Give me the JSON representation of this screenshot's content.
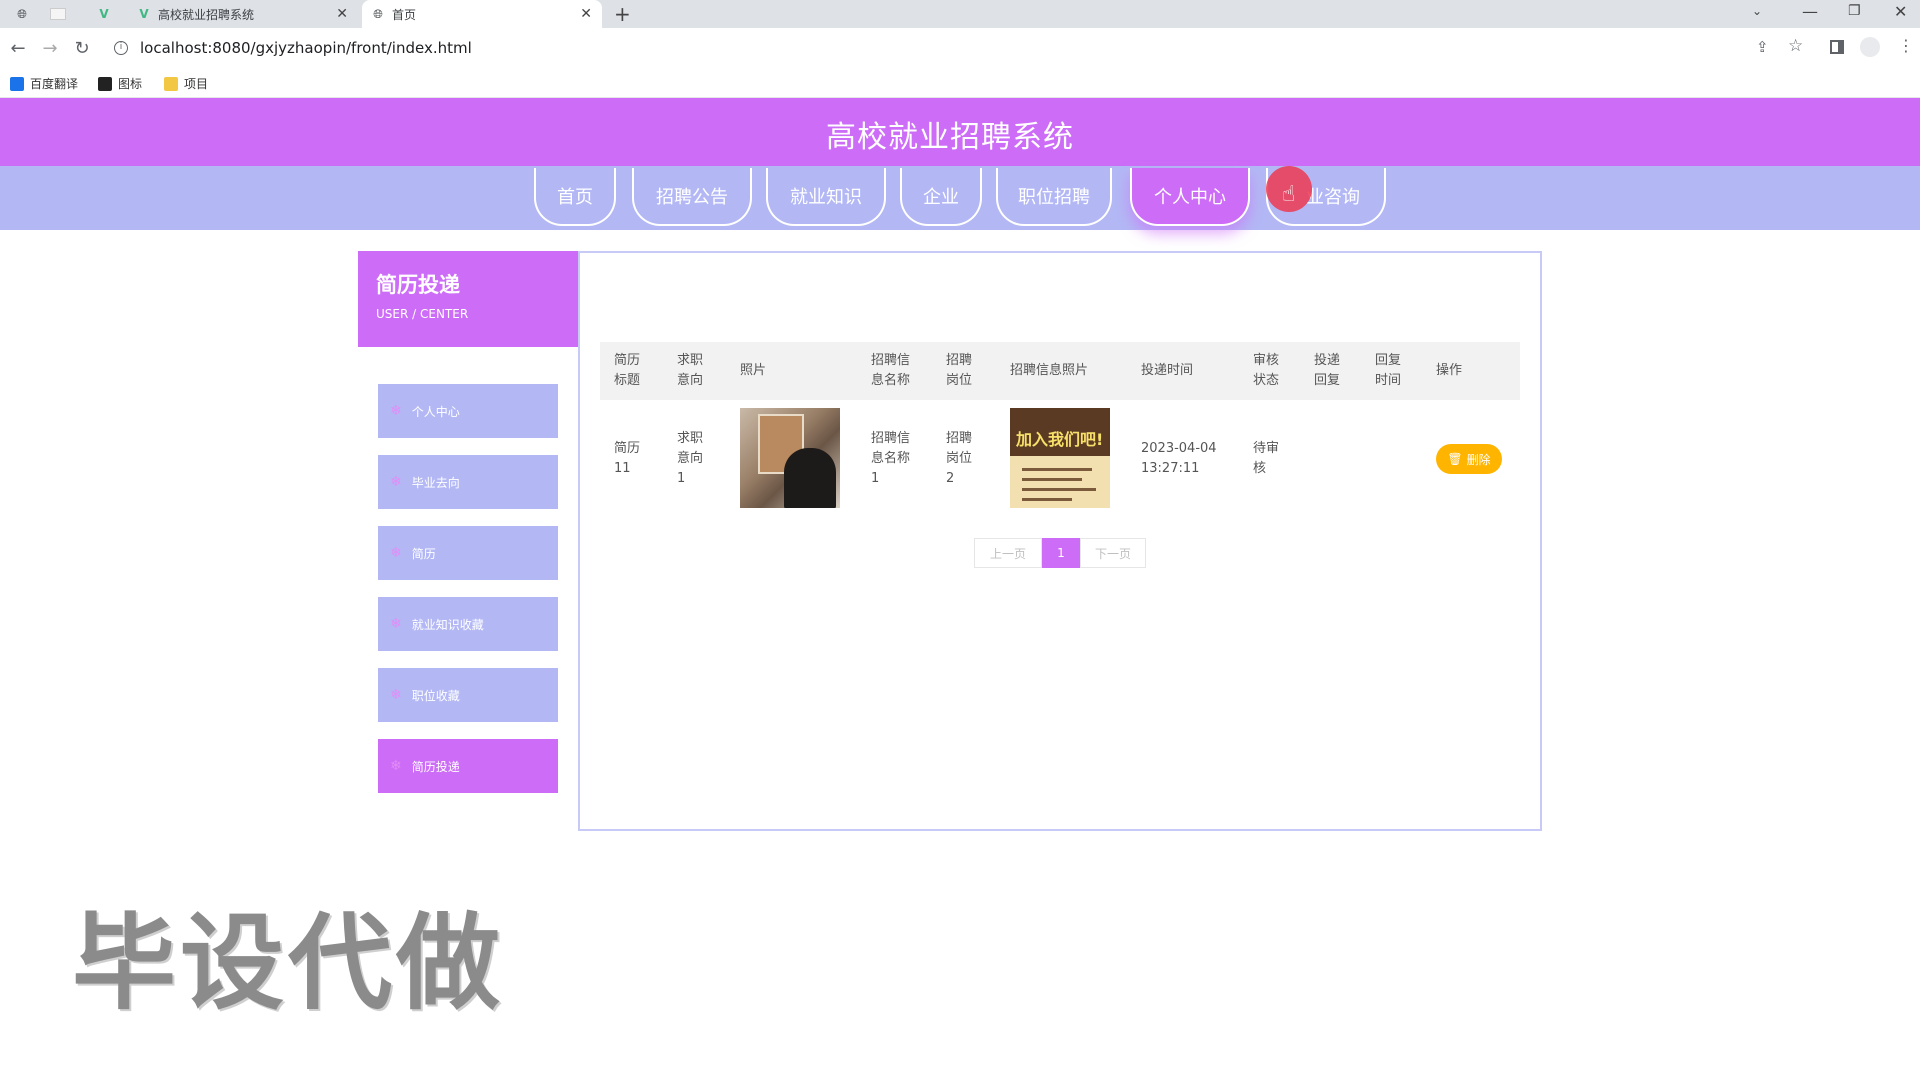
{
  "browser": {
    "tabs": [
      {
        "title": "高校就业招聘系统"
      },
      {
        "title": "首页"
      }
    ],
    "new_tab_symbol": "+",
    "url": "localhost:8080/gxjyzhaopin/front/index.html",
    "bookmarks": [
      {
        "label": "百度翻译",
        "icon": "translate-icon",
        "color": "#1a73e8"
      },
      {
        "label": "图标",
        "icon": "image-icon",
        "color": "#222222"
      },
      {
        "label": "项目",
        "icon": "folder-icon",
        "color": "#f2c744"
      }
    ]
  },
  "site": {
    "title": "高校就业招聘系统",
    "nav": [
      {
        "label": "首页"
      },
      {
        "label": "招聘公告"
      },
      {
        "label": "就业知识"
      },
      {
        "label": "企业"
      },
      {
        "label": "职位招聘"
      },
      {
        "label": "个人中心",
        "active": true
      },
      {
        "label": "就业咨询"
      }
    ],
    "nav_partial_label": "业咨询"
  },
  "sidebar": {
    "title": "简历投递",
    "subtitle": "USER / CENTER",
    "items": [
      {
        "label": "个人中心"
      },
      {
        "label": "毕业去向"
      },
      {
        "label": "简历"
      },
      {
        "label": "就业知识收藏"
      },
      {
        "label": "职位收藏"
      },
      {
        "label": "简历投递",
        "active": true
      }
    ]
  },
  "table": {
    "headers": [
      {
        "l1": "简历",
        "l2": "标题"
      },
      {
        "l1": "求职",
        "l2": "意向"
      },
      {
        "l1": "照片",
        "l2": ""
      },
      {
        "l1": "招聘信",
        "l2": "息名称"
      },
      {
        "l1": "招聘",
        "l2": "岗位"
      },
      {
        "l1": "招聘信息照片",
        "l2": ""
      },
      {
        "l1": "投递时间",
        "l2": ""
      },
      {
        "l1": "审核",
        "l2": "状态"
      },
      {
        "l1": "投递",
        "l2": "回复"
      },
      {
        "l1": "回复",
        "l2": "时间"
      },
      {
        "l1": "操作",
        "l2": ""
      }
    ],
    "row": {
      "resume_title": [
        "简历",
        "11"
      ],
      "intention": [
        "求职",
        "意向",
        "1"
      ],
      "job_info_name": [
        "招聘信",
        "息名称",
        "1"
      ],
      "job_position": [
        "招聘",
        "岗位",
        "2"
      ],
      "delivery_time": [
        "2023-04-04",
        "13:27:11"
      ],
      "review_status": [
        "待审",
        "核"
      ],
      "reply": "",
      "reply_time": "",
      "poster_text": "加入我们吧!",
      "delete_label": "删除"
    }
  },
  "pagination": {
    "prev": "上一页",
    "current": "1",
    "next": "下一页"
  },
  "watermark": "毕设代做",
  "colors": {
    "primary": "#cc6cf7",
    "secondary": "#b3b8f5",
    "delete": "#ffb400",
    "cursor": "#ec3850"
  }
}
